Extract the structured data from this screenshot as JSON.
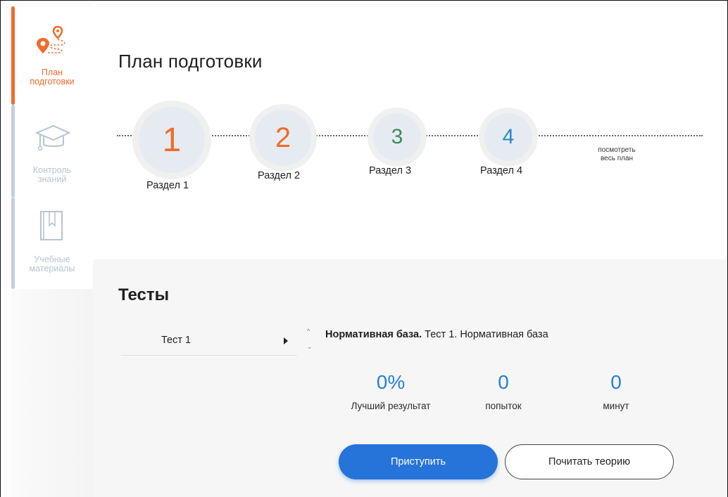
{
  "sidebar": {
    "items": [
      {
        "label": "План подготовки",
        "icon": "route-pin-icon",
        "active": true
      },
      {
        "label": "Контроль знаний",
        "icon": "graduation-cap-icon",
        "active": false
      },
      {
        "label": "Учебные материалы",
        "icon": "book-icon",
        "active": false
      }
    ]
  },
  "page": {
    "title": "План подготовки"
  },
  "plan": {
    "steps": [
      {
        "number": "1",
        "label": "Раздел 1"
      },
      {
        "number": "2",
        "label": "Раздел 2"
      },
      {
        "number": "3",
        "label": "Раздел 3"
      },
      {
        "number": "4",
        "label": "Раздел 4"
      }
    ],
    "view_all_line1": "посмотреть",
    "view_all_line2": "весь план"
  },
  "tests": {
    "title": "Тесты",
    "items": [
      {
        "label": "Тест 1"
      }
    ],
    "selected": {
      "bold_title": "Нормативная база.",
      "rest_title": " Тест 1. Нормативная база"
    },
    "stats": [
      {
        "value": "0%",
        "caption": "Лучший результат"
      },
      {
        "value": "0",
        "caption": "попыток"
      },
      {
        "value": "0",
        "caption": "минут"
      }
    ],
    "start_button": "Приступить",
    "theory_button": "Почитать теорию"
  },
  "colors": {
    "accent": "#f26b2a",
    "primary": "#2673d9",
    "step3": "#3b8a5c",
    "step4": "#2a87c7",
    "inactive": "#b8c4d3"
  }
}
